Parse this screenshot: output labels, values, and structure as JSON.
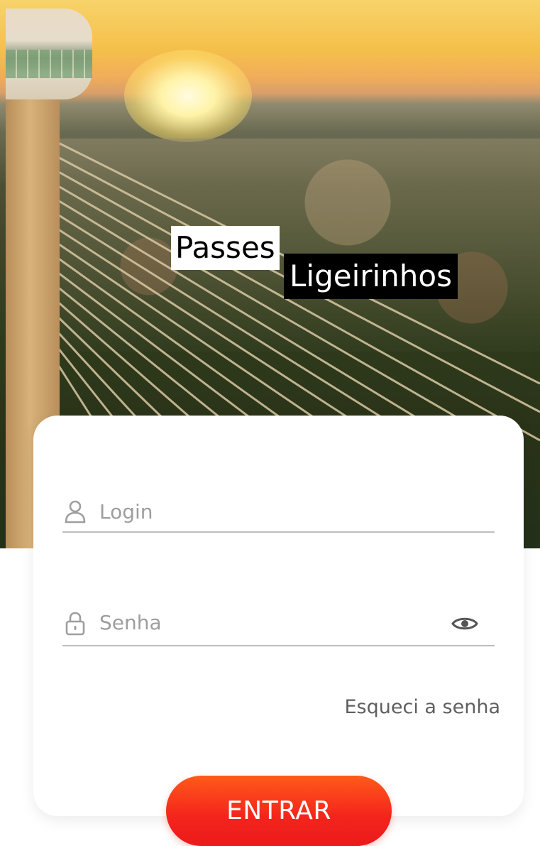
{
  "brand": {
    "title_part1": "Passes",
    "title_part2": "Ligeirinhos"
  },
  "login_form": {
    "login_placeholder": "Login",
    "login_value": "",
    "login_icon": "user-icon",
    "password_placeholder": "Senha",
    "password_value": "",
    "password_icon": "lock-icon",
    "password_toggle_icon": "eye-icon",
    "forgot_password_label": "Esqueci a senha",
    "submit_label": "ENTRAR"
  },
  "colors": {
    "accent": "#f4231c",
    "accent_light": "#ff5a1a",
    "field_line": "#bdbdbd",
    "placeholder": "#9e9e9e",
    "link": "#5f5f5f",
    "card": "#ffffff"
  }
}
